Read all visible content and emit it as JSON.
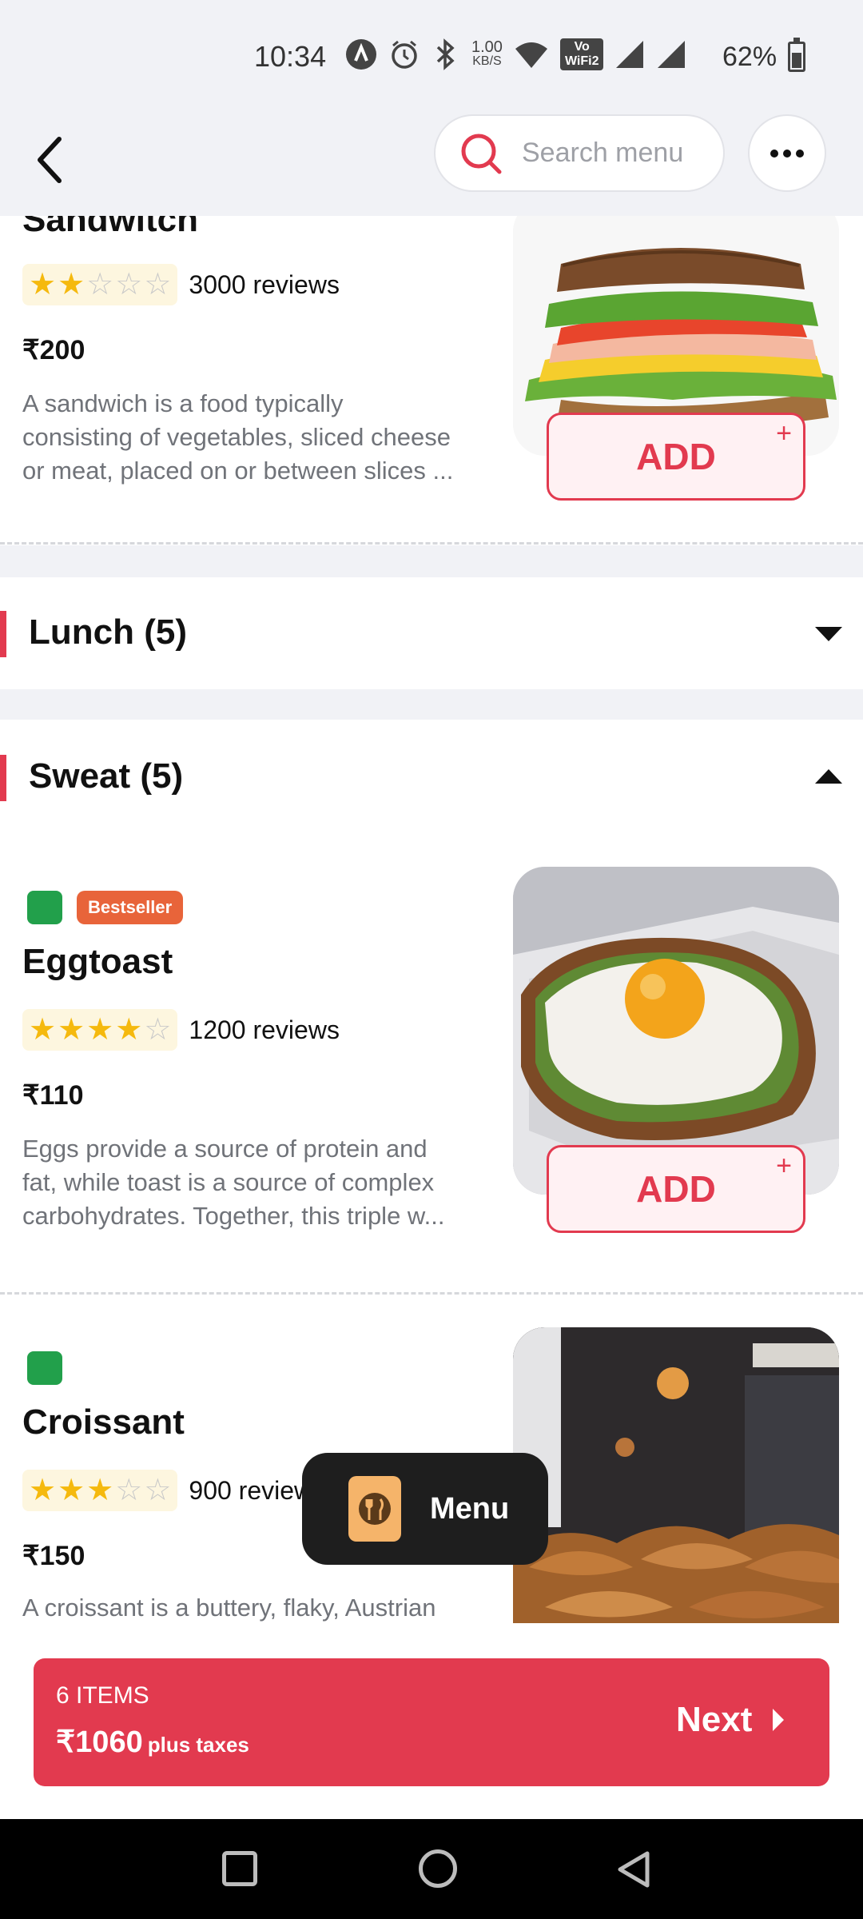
{
  "status_bar": {
    "time": "10:34",
    "net_speed_top": "1.00",
    "net_speed_bottom": "KB/S",
    "wifi_label_top": "Vo",
    "wifi_label_bottom": "WiFi2",
    "battery": "62%",
    "icons": [
      "app-a-icon",
      "alarm-icon",
      "bluetooth-icon",
      "net-speed-icon",
      "wifi-icon",
      "vowifi-icon",
      "signal-icon",
      "signal-icon",
      "battery-icon"
    ]
  },
  "header": {
    "search_placeholder": "Search menu",
    "back_icon": "chevron-left-icon",
    "search_icon": "search-icon",
    "more_icon": "more-horizontal-icon"
  },
  "items": [
    {
      "name": "Sandwitch",
      "rating": 2,
      "max_rating": 5,
      "reviews": "3000 reviews",
      "price": "₹200",
      "description_lines": [
        "A sandwich is a food typically",
        "consisting of vegetables, sliced cheese",
        "or meat, placed on or between slices ..."
      ],
      "add_label": "ADD",
      "add_plus": "+"
    },
    {
      "name": "Eggtoast",
      "badge": "Bestseller",
      "rating": 4,
      "max_rating": 5,
      "reviews": "1200 reviews",
      "price": "₹110",
      "description_lines": [
        "Eggs provide a source of protein and",
        "fat, while toast is a source of complex",
        "carbohydrates. Together, this triple w..."
      ],
      "add_label": "ADD",
      "add_plus": "+"
    },
    {
      "name": "Croissant",
      "rating": 3,
      "max_rating": 5,
      "reviews": "900 reviews",
      "price": "₹150",
      "description_lines": [
        "A croissant is a buttery, flaky, Austrian"
      ]
    }
  ],
  "sections": [
    {
      "title": "Lunch (5)",
      "state": "collapsed"
    },
    {
      "title": "Sweat (5)",
      "state": "expanded"
    }
  ],
  "fab": {
    "label": "Menu",
    "icon": "utensils-icon"
  },
  "cart": {
    "count": "6 ITEMS",
    "total": "₹1060",
    "taxes": "plus taxes",
    "next_label": "Next"
  },
  "colors": {
    "accent": "#e23a4f",
    "veg": "#22a04b",
    "badge": "#e8643a",
    "star": "#f5b90e",
    "background": "#f1f2f6"
  }
}
